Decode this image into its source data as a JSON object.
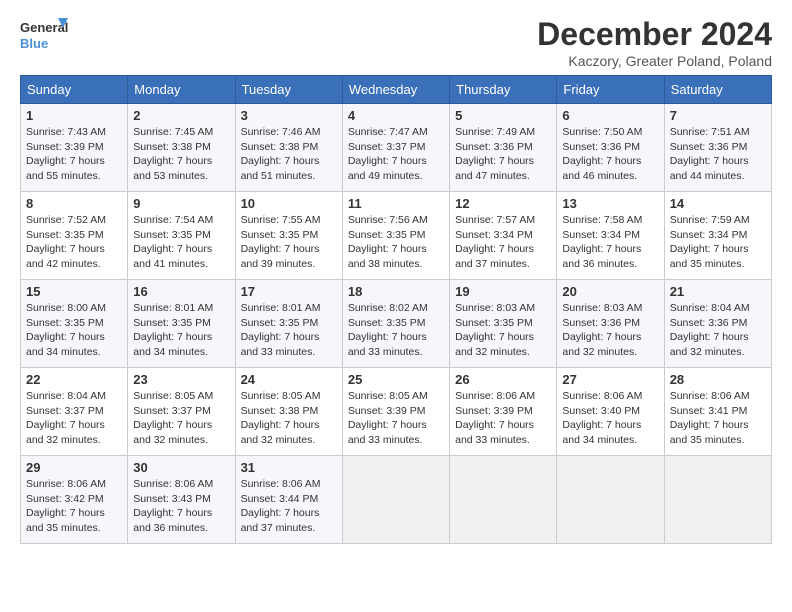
{
  "logo": {
    "line1": "General",
    "line2": "Blue"
  },
  "title": "December 2024",
  "subtitle": "Kaczory, Greater Poland, Poland",
  "weekdays": [
    "Sunday",
    "Monday",
    "Tuesday",
    "Wednesday",
    "Thursday",
    "Friday",
    "Saturday"
  ],
  "weeks": [
    [
      {
        "day": "1",
        "sunrise": "7:43 AM",
        "sunset": "3:39 PM",
        "daylight": "7 hours and 55 minutes."
      },
      {
        "day": "2",
        "sunrise": "7:45 AM",
        "sunset": "3:38 PM",
        "daylight": "7 hours and 53 minutes."
      },
      {
        "day": "3",
        "sunrise": "7:46 AM",
        "sunset": "3:38 PM",
        "daylight": "7 hours and 51 minutes."
      },
      {
        "day": "4",
        "sunrise": "7:47 AM",
        "sunset": "3:37 PM",
        "daylight": "7 hours and 49 minutes."
      },
      {
        "day": "5",
        "sunrise": "7:49 AM",
        "sunset": "3:36 PM",
        "daylight": "7 hours and 47 minutes."
      },
      {
        "day": "6",
        "sunrise": "7:50 AM",
        "sunset": "3:36 PM",
        "daylight": "7 hours and 46 minutes."
      },
      {
        "day": "7",
        "sunrise": "7:51 AM",
        "sunset": "3:36 PM",
        "daylight": "7 hours and 44 minutes."
      }
    ],
    [
      {
        "day": "8",
        "sunrise": "7:52 AM",
        "sunset": "3:35 PM",
        "daylight": "7 hours and 42 minutes."
      },
      {
        "day": "9",
        "sunrise": "7:54 AM",
        "sunset": "3:35 PM",
        "daylight": "7 hours and 41 minutes."
      },
      {
        "day": "10",
        "sunrise": "7:55 AM",
        "sunset": "3:35 PM",
        "daylight": "7 hours and 39 minutes."
      },
      {
        "day": "11",
        "sunrise": "7:56 AM",
        "sunset": "3:35 PM",
        "daylight": "7 hours and 38 minutes."
      },
      {
        "day": "12",
        "sunrise": "7:57 AM",
        "sunset": "3:34 PM",
        "daylight": "7 hours and 37 minutes."
      },
      {
        "day": "13",
        "sunrise": "7:58 AM",
        "sunset": "3:34 PM",
        "daylight": "7 hours and 36 minutes."
      },
      {
        "day": "14",
        "sunrise": "7:59 AM",
        "sunset": "3:34 PM",
        "daylight": "7 hours and 35 minutes."
      }
    ],
    [
      {
        "day": "15",
        "sunrise": "8:00 AM",
        "sunset": "3:35 PM",
        "daylight": "7 hours and 34 minutes."
      },
      {
        "day": "16",
        "sunrise": "8:01 AM",
        "sunset": "3:35 PM",
        "daylight": "7 hours and 34 minutes."
      },
      {
        "day": "17",
        "sunrise": "8:01 AM",
        "sunset": "3:35 PM",
        "daylight": "7 hours and 33 minutes."
      },
      {
        "day": "18",
        "sunrise": "8:02 AM",
        "sunset": "3:35 PM",
        "daylight": "7 hours and 33 minutes."
      },
      {
        "day": "19",
        "sunrise": "8:03 AM",
        "sunset": "3:35 PM",
        "daylight": "7 hours and 32 minutes."
      },
      {
        "day": "20",
        "sunrise": "8:03 AM",
        "sunset": "3:36 PM",
        "daylight": "7 hours and 32 minutes."
      },
      {
        "day": "21",
        "sunrise": "8:04 AM",
        "sunset": "3:36 PM",
        "daylight": "7 hours and 32 minutes."
      }
    ],
    [
      {
        "day": "22",
        "sunrise": "8:04 AM",
        "sunset": "3:37 PM",
        "daylight": "7 hours and 32 minutes."
      },
      {
        "day": "23",
        "sunrise": "8:05 AM",
        "sunset": "3:37 PM",
        "daylight": "7 hours and 32 minutes."
      },
      {
        "day": "24",
        "sunrise": "8:05 AM",
        "sunset": "3:38 PM",
        "daylight": "7 hours and 32 minutes."
      },
      {
        "day": "25",
        "sunrise": "8:05 AM",
        "sunset": "3:39 PM",
        "daylight": "7 hours and 33 minutes."
      },
      {
        "day": "26",
        "sunrise": "8:06 AM",
        "sunset": "3:39 PM",
        "daylight": "7 hours and 33 minutes."
      },
      {
        "day": "27",
        "sunrise": "8:06 AM",
        "sunset": "3:40 PM",
        "daylight": "7 hours and 34 minutes."
      },
      {
        "day": "28",
        "sunrise": "8:06 AM",
        "sunset": "3:41 PM",
        "daylight": "7 hours and 35 minutes."
      }
    ],
    [
      {
        "day": "29",
        "sunrise": "8:06 AM",
        "sunset": "3:42 PM",
        "daylight": "7 hours and 35 minutes."
      },
      {
        "day": "30",
        "sunrise": "8:06 AM",
        "sunset": "3:43 PM",
        "daylight": "7 hours and 36 minutes."
      },
      {
        "day": "31",
        "sunrise": "8:06 AM",
        "sunset": "3:44 PM",
        "daylight": "7 hours and 37 minutes."
      },
      null,
      null,
      null,
      null
    ]
  ]
}
